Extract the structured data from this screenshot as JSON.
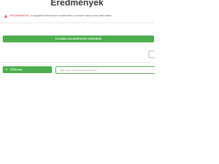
{
  "page": {
    "title": "Eredmények"
  },
  "alert": {
    "icon": "warning-icon",
    "code": "RR415099001HU",
    "message": "A megadott küldeményre vonatkozóan a rendszer sajnos nem talált adatot.",
    "color": "#cc3333"
  },
  "actions": {
    "more_search_label": "TOVÁBBI KÜLDEMÉNYEK KERESÉSE",
    "home_label": "FŐOLDAL",
    "home_icon": "chevron-double-left-icon"
  },
  "search": {
    "placeholder": "Adja meg a küldeményazonosítókat"
  },
  "colors": {
    "accent": "#4cae4c",
    "text": "#3a3a3a"
  }
}
